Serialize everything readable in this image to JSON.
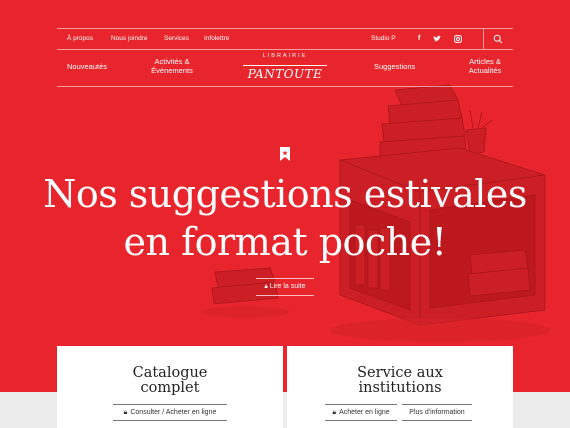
{
  "utility_nav": {
    "links": [
      "À propos",
      "Nous joindre",
      "Services",
      "Infolettre"
    ],
    "account": "Studio P",
    "social": [
      "facebook-icon",
      "twitter-icon",
      "instagram-icon"
    ],
    "search": "search-icon"
  },
  "main_nav": {
    "left": [
      "Nouveautés",
      "Activités & Événements"
    ],
    "right": [
      "Suggestions",
      "Articles & Actualités"
    ]
  },
  "logo": {
    "top": "LIBRAIRIE",
    "main": "PANTOUTE"
  },
  "hero": {
    "title_line1": "Nos suggestions estivales",
    "title_line2": "en format poche!",
    "read_more": "Lire la suite"
  },
  "cards": [
    {
      "title_line1": "Catalogue",
      "title_line2": "complet",
      "buttons": [
        "Consulter / Acheter en ligne"
      ]
    },
    {
      "title_line1": "Service aux",
      "title_line2": "institutions",
      "buttons": [
        "Acheter en ligne",
        "Plus d'information"
      ]
    }
  ],
  "colors": {
    "brand_red": "#e8252c",
    "card_bg": "#ffffff",
    "band_bg": "#ececec"
  }
}
